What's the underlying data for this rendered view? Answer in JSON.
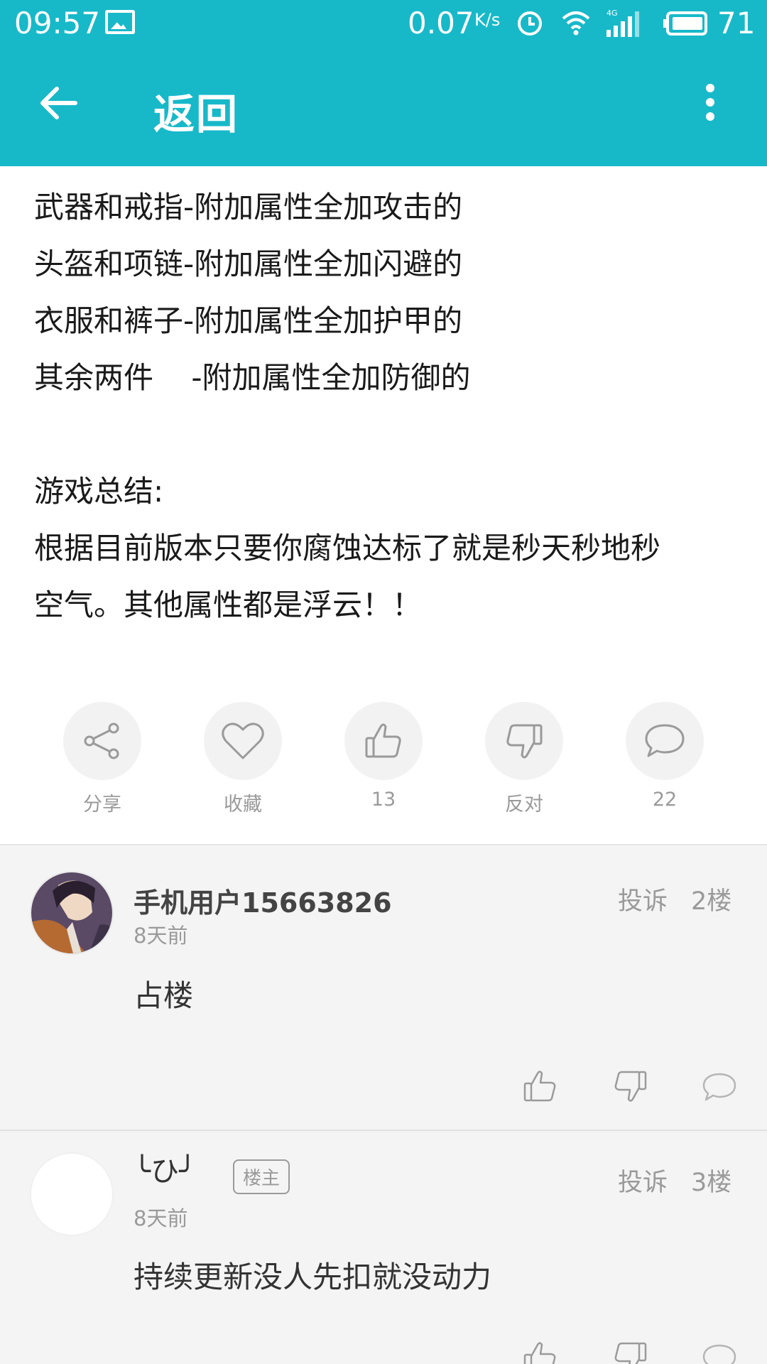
{
  "status_bar": {
    "time": "09:57",
    "speed": "0.07",
    "speed_unit": "K/s",
    "battery": "71",
    "network": "4G"
  },
  "app_bar": {
    "title": "返回"
  },
  "post": {
    "lines": [
      "武器和戒指-附加属性全加攻击的",
      "头盔和项链-附加属性全加闪避的",
      "衣服和裤子-附加属性全加护甲的",
      "其余两件    -附加属性全加防御的",
      "",
      "游戏总结:",
      "根据目前版本只要你腐蚀达标了就是秒天秒地秒",
      "空气。其他属性都是浮云！！"
    ]
  },
  "actions": [
    {
      "icon": "share-icon",
      "label": "分享"
    },
    {
      "icon": "heart-icon",
      "label": "收藏"
    },
    {
      "icon": "thumbs-up-icon",
      "label": "13"
    },
    {
      "icon": "thumbs-down-icon",
      "label": "反对"
    },
    {
      "icon": "comment-icon",
      "label": "22"
    }
  ],
  "comments": [
    {
      "username": "手机用户15663826",
      "time": "8天前",
      "report": "投诉",
      "floor": "2楼",
      "text": "占楼",
      "badge": ""
    },
    {
      "username": "╰ひ╯",
      "time": "8天前",
      "report": "投诉",
      "floor": "3楼",
      "text": "持续更新没人先扣就没动力",
      "badge": "楼主"
    }
  ],
  "colors": {
    "accent": "#17b9c9",
    "comment_bg": "#f4f4f4",
    "muted_text": "#9a9a9a"
  }
}
